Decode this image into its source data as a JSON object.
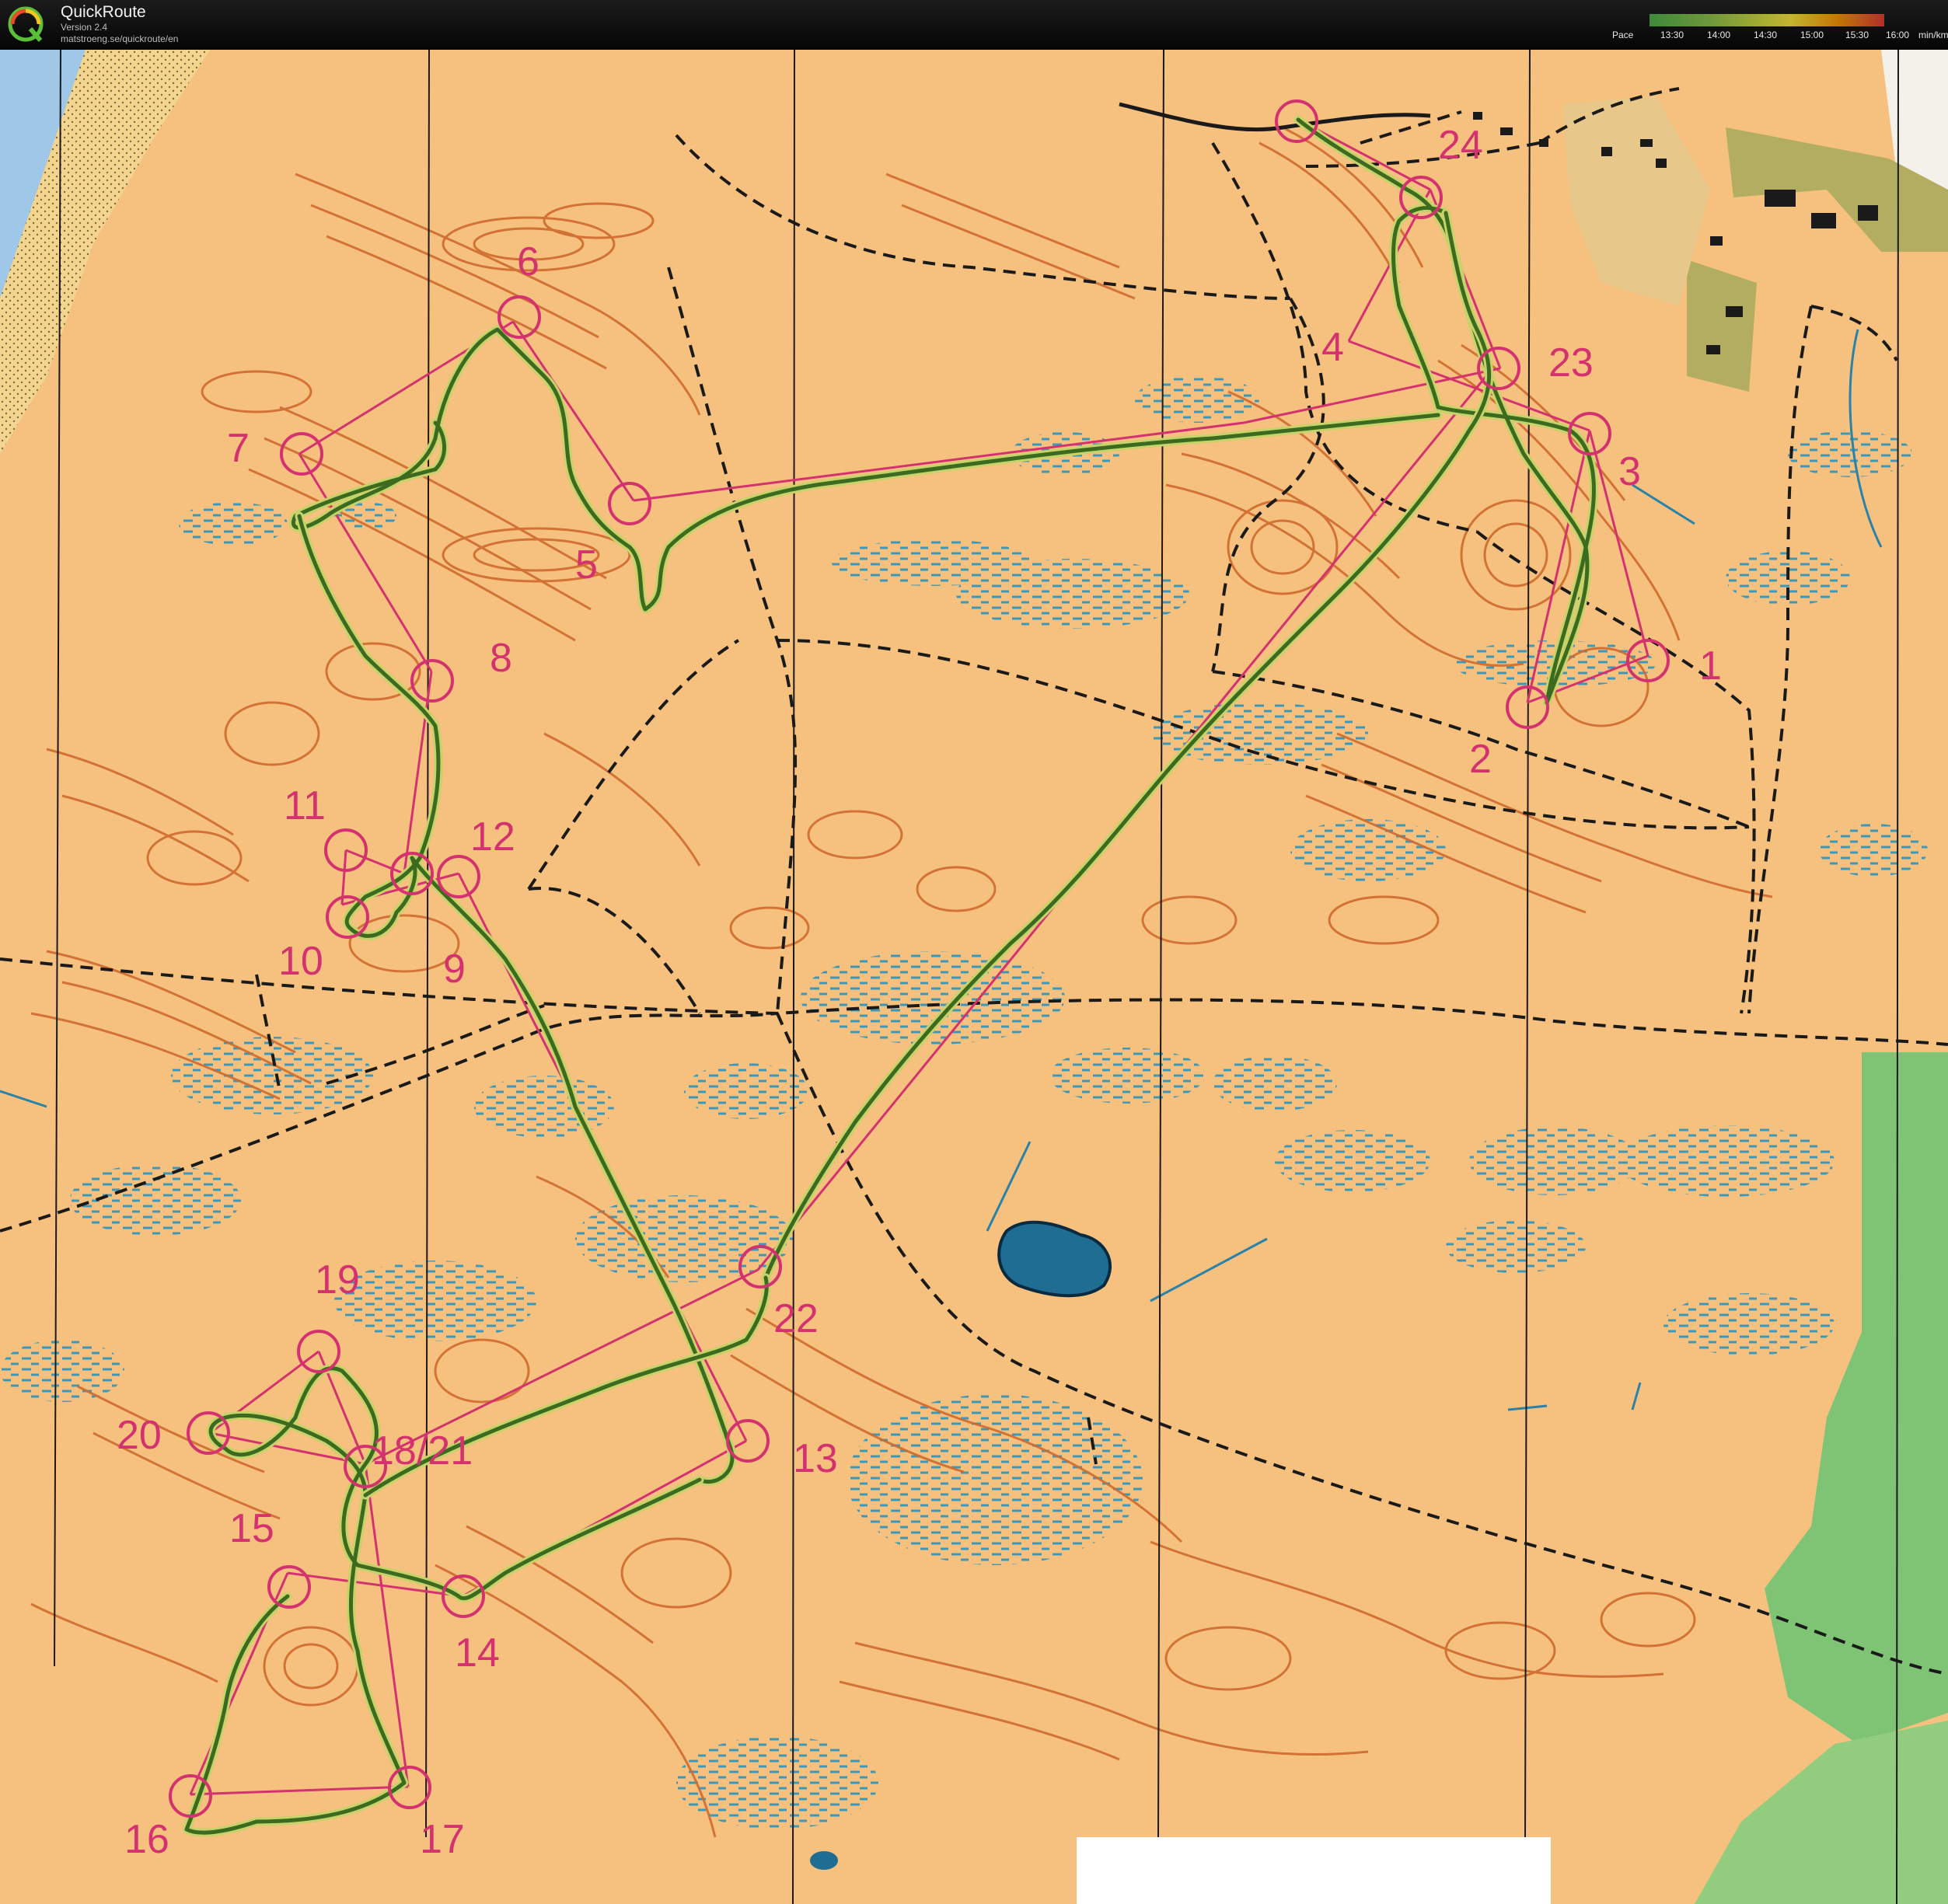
{
  "app": {
    "logo_letter": "Q",
    "title": "QuickRoute",
    "version": "Version 2.4",
    "url": "matstroeng.se/quickroute/en"
  },
  "pace_legend": {
    "label": "Pace",
    "ticks": [
      "13:30",
      "14:00",
      "14:30",
      "15:00",
      "15:30",
      "16:00"
    ],
    "unit": "min/km"
  },
  "colors": {
    "map_background": "#f6c17f",
    "contour": "#cf6a2e",
    "marsh": "#3d98b8",
    "water": "#1f6d93",
    "course": "#d4326e",
    "route_track": "#3c6a1e",
    "track_outline": "#c6d36a",
    "path": "#1a1a1a",
    "field_green": "#7fc475",
    "settlement": "#8a7a3a",
    "sea": "#9fc7e7",
    "sand": "#f3d590"
  },
  "course": {
    "controls": [
      {
        "id": "1",
        "label": "1"
      },
      {
        "id": "2",
        "label": "2"
      },
      {
        "id": "3",
        "label": "3"
      },
      {
        "id": "4",
        "label": "4"
      },
      {
        "id": "5",
        "label": "5"
      },
      {
        "id": "6",
        "label": "6"
      },
      {
        "id": "7",
        "label": "7"
      },
      {
        "id": "8",
        "label": "8"
      },
      {
        "id": "9",
        "label": "9"
      },
      {
        "id": "10",
        "label": "10"
      },
      {
        "id": "11",
        "label": "11"
      },
      {
        "id": "12",
        "label": "12"
      },
      {
        "id": "13",
        "label": "13"
      },
      {
        "id": "14",
        "label": "14"
      },
      {
        "id": "15",
        "label": "15"
      },
      {
        "id": "16",
        "label": "16"
      },
      {
        "id": "17",
        "label": "17"
      },
      {
        "id": "18",
        "label": "18/21"
      },
      {
        "id": "19",
        "label": "19"
      },
      {
        "id": "20",
        "label": "20"
      },
      {
        "id": "22",
        "label": "22"
      },
      {
        "id": "23",
        "label": "23"
      },
      {
        "id": "24",
        "label": "24"
      }
    ]
  }
}
